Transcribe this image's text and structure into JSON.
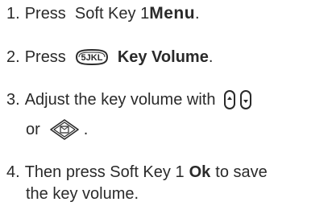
{
  "steps": [
    {
      "num": "1.",
      "pre": "Press  Soft Key 1",
      "bold": "Menu",
      "post": "."
    },
    {
      "num": "2.",
      "pre": "Press",
      "key_icon": "5-jkl-key-icon",
      "key_label": "5JKL",
      "bold": "Key Volume",
      "post": "."
    },
    {
      "num": "3.",
      "pre": "Adjust the key volume with",
      "icon_up": "volume-up-key-icon",
      "icon_down": "volume-down-key-icon",
      "line2_pre": "or",
      "icon_nav": "navigation-key-icon",
      "line2_post": "."
    },
    {
      "num": "4.",
      "pre": "Then press Soft Key 1",
      "bold": "Ok",
      "post": "to save",
      "line2": "the key volume."
    }
  ]
}
